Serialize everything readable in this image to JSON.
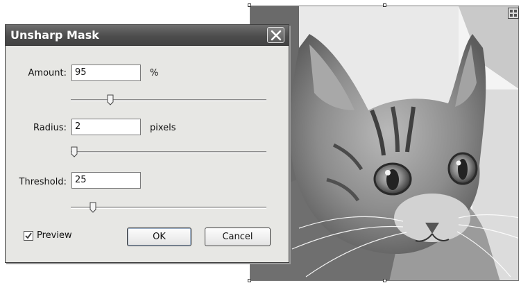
{
  "dialog": {
    "title": "Unsharp Mask",
    "amount": {
      "label": "Amount:",
      "value": "95",
      "unit": "%",
      "slider_fraction": 0.19
    },
    "radius": {
      "label": "Radius:",
      "value": "2",
      "unit": "pixels",
      "slider_fraction": 0.0
    },
    "threshold": {
      "label": "Threshold:",
      "value": "25",
      "unit": "",
      "slider_fraction": 0.1
    },
    "preview": {
      "label": "Preview",
      "checked": true
    },
    "ok_label": "OK",
    "cancel_label": "Cancel"
  },
  "image": {
    "subject": "kitten-photo",
    "mode": "grayscale"
  },
  "icons": {
    "close": "close-icon",
    "transform": "transform-icon",
    "slider_thumb": "slider-thumb-icon",
    "checkmark": "checkmark-icon"
  }
}
